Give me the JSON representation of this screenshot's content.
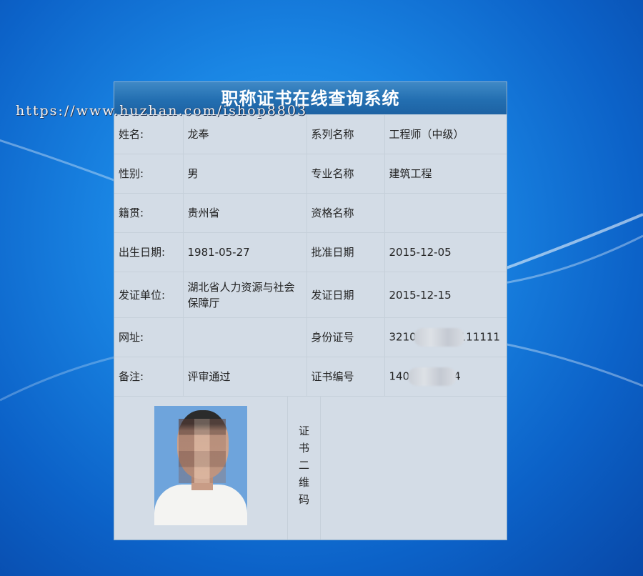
{
  "title": "职称证书在线查询系统",
  "watermark": "https://www.huzhan.com/ishop8803",
  "colors": {
    "background": "#1a86e4",
    "title_bar": "#236fb1",
    "card": "#d3dce6"
  },
  "rows": [
    {
      "label1": "姓名:",
      "value1": "龙奉",
      "label2": "系列名称",
      "value2": "工程师（中级）"
    },
    {
      "label1": "性别:",
      "value1": "男",
      "label2": "专业名称",
      "value2": "建筑工程"
    },
    {
      "label1": "籍贯:",
      "value1": "贵州省",
      "label2": "资格名称",
      "value2": ""
    },
    {
      "label1": "出生日期:",
      "value1": "1981-05-27",
      "label2": "批准日期",
      "value2": "2015-12-05"
    },
    {
      "label1": "发证单位:",
      "value1": "湖北省人力资源与社会保障厅",
      "label2": "发证日期",
      "value2": "2015-12-15"
    },
    {
      "label1": "网址:",
      "value1": "",
      "label2": "身份证号",
      "value2_prefix": "3210",
      "value2_suffix": "111111"
    },
    {
      "label1": "备注:",
      "value1": "评审通过",
      "label2": "证书编号",
      "value2_prefix": "140",
      "value2_suffix": "4"
    }
  ],
  "photo_icon": "person-photo-blurred",
  "qr_label": "证书二维码"
}
